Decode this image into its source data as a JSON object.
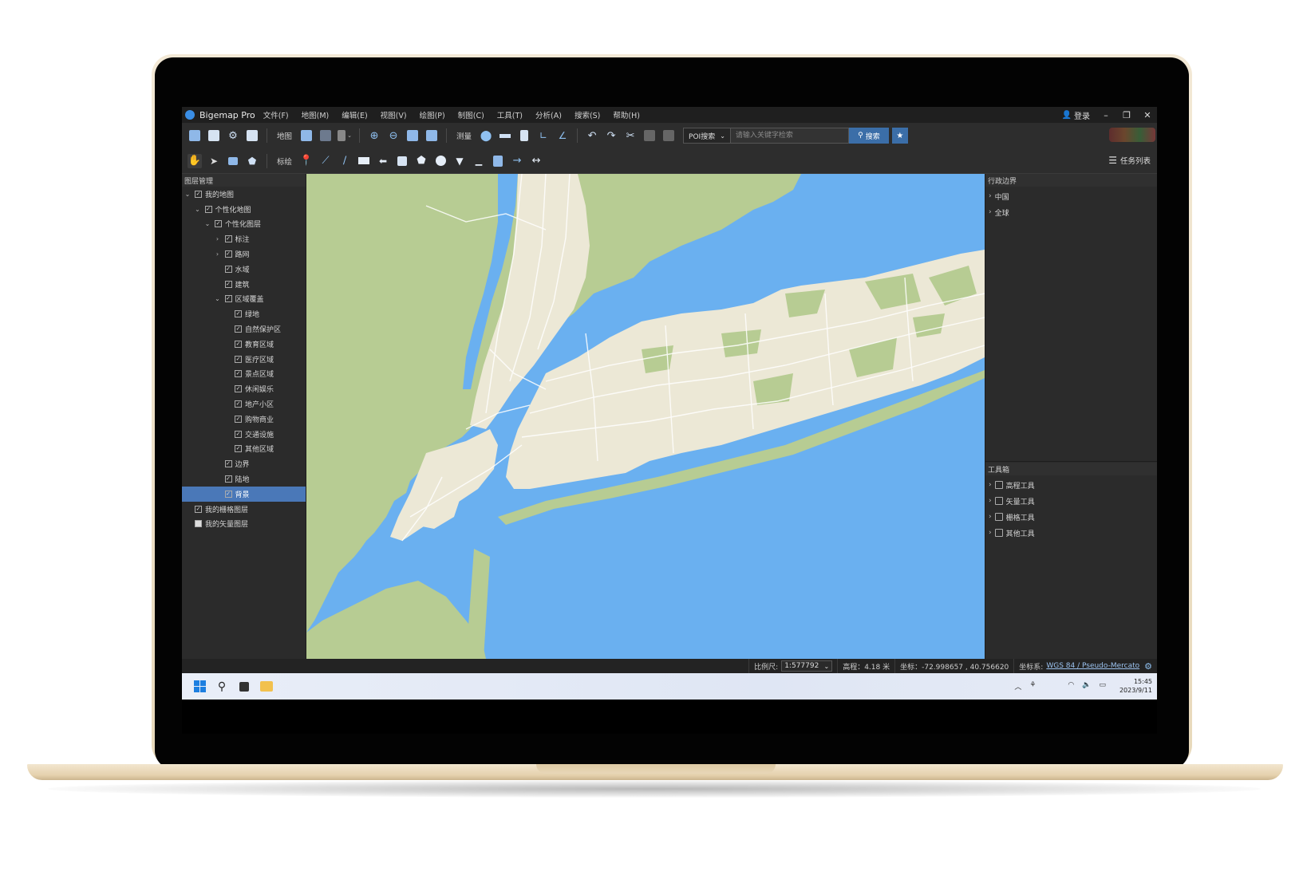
{
  "window": {
    "app_title": "Bigemap Pro",
    "menu": [
      "文件(F)",
      "地图(M)",
      "编辑(E)",
      "视图(V)",
      "绘图(P)",
      "制图(C)",
      "工具(T)",
      "分析(A)",
      "搜索(S)",
      "帮助(H)"
    ],
    "login_label": "登录",
    "minimize": "–",
    "restore": "❐",
    "close": "✕"
  },
  "toolbar1": {
    "map_label": "地图",
    "measure_label": "测量",
    "poi_select": "POI搜索",
    "search_placeholder": "请输入关键字检索",
    "search_button": "搜索"
  },
  "toolbar2": {
    "annotate_label": "标绘",
    "task_list": "任务列表"
  },
  "layer_panel": {
    "title": "图层管理",
    "items": [
      {
        "label": "我的地图",
        "level": 0,
        "expand": "open",
        "checked": true
      },
      {
        "label": "个性化地图",
        "level": 1,
        "expand": "open",
        "checked": true
      },
      {
        "label": "个性化图层",
        "level": 2,
        "expand": "open",
        "checked": true
      },
      {
        "label": "标注",
        "level": 3,
        "expand": "closed",
        "checked": true
      },
      {
        "label": "路网",
        "level": 3,
        "expand": "closed",
        "checked": true
      },
      {
        "label": "水域",
        "level": 3,
        "expand": "none",
        "checked": true
      },
      {
        "label": "建筑",
        "level": 3,
        "expand": "none",
        "checked": true
      },
      {
        "label": "区域覆盖",
        "level": 3,
        "expand": "open",
        "checked": true
      },
      {
        "label": "绿地",
        "level": 4,
        "expand": "none",
        "checked": true
      },
      {
        "label": "自然保护区",
        "level": 4,
        "expand": "none",
        "checked": true
      },
      {
        "label": "教育区域",
        "level": 4,
        "expand": "none",
        "checked": true
      },
      {
        "label": "医疗区域",
        "level": 4,
        "expand": "none",
        "checked": true
      },
      {
        "label": "景点区域",
        "level": 4,
        "expand": "none",
        "checked": true
      },
      {
        "label": "休闲娱乐",
        "level": 4,
        "expand": "none",
        "checked": true
      },
      {
        "label": "地产小区",
        "level": 4,
        "expand": "none",
        "checked": true
      },
      {
        "label": "购物商业",
        "level": 4,
        "expand": "none",
        "checked": true
      },
      {
        "label": "交通设施",
        "level": 4,
        "expand": "none",
        "checked": true
      },
      {
        "label": "其他区域",
        "level": 4,
        "expand": "none",
        "checked": true
      },
      {
        "label": "边界",
        "level": 3,
        "expand": "none",
        "checked": true
      },
      {
        "label": "陆地",
        "level": 3,
        "expand": "none",
        "checked": true
      },
      {
        "label": "背景",
        "level": 3,
        "expand": "none",
        "checked": true,
        "selected": true
      },
      {
        "label": "我的栅格图层",
        "level": 0,
        "expand": "none",
        "checked": true
      },
      {
        "label": "我的矢量图层",
        "level": 0,
        "expand": "none",
        "checked": false
      }
    ]
  },
  "admin_panel": {
    "title": "行政边界",
    "items": [
      "中国",
      "全球"
    ]
  },
  "toolbox_panel": {
    "title": "工具箱",
    "items": [
      "高程工具",
      "矢量工具",
      "栅格工具",
      "其他工具"
    ]
  },
  "status": {
    "scale_label": "比例尺:",
    "scale_value": "1:577792",
    "elevation": "高程：4.18 米",
    "coords": "坐标：-72.998657 , 40.756620",
    "crs_label": "坐标系:",
    "crs_value": "WGS 84 / Pseudo-Mercato"
  },
  "taskbar": {
    "time": "15:45",
    "date": "2023/9/11"
  },
  "colors": {
    "water": "#6ab0f0",
    "land": "#b7cc93",
    "urban": "#ece8d6",
    "selected": "#4a78b8",
    "accent": "#3b6ea8"
  }
}
